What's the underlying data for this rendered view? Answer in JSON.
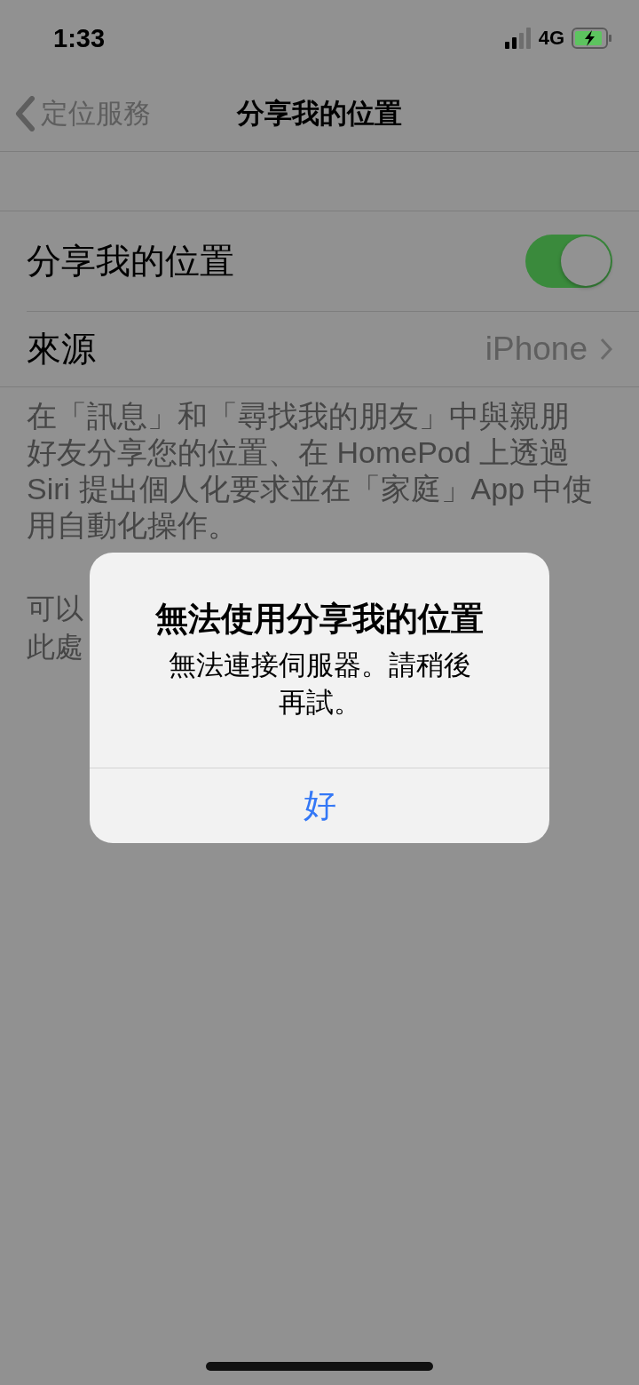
{
  "status_bar": {
    "time": "1:33",
    "network": "4G",
    "charging": true
  },
  "nav": {
    "back": "定位服務",
    "title": "分享我的位置"
  },
  "share_row": {
    "label": "分享我的位置",
    "on": true
  },
  "source_row": {
    "label": "來源",
    "value": "iPhone"
  },
  "description": "在「訊息」和「尋找我的朋友」中與親朋好友分享您的位置、在 HomePod 上透過 Siri 提出個人化要求並在「家庭」App 中使用自動化操作。",
  "footer_lines": [
    "可以",
    "此處"
  ],
  "alert": {
    "title": "無法使用分享我的位置",
    "message": "無法連接伺服器。請稍後再試。",
    "button": "好"
  }
}
